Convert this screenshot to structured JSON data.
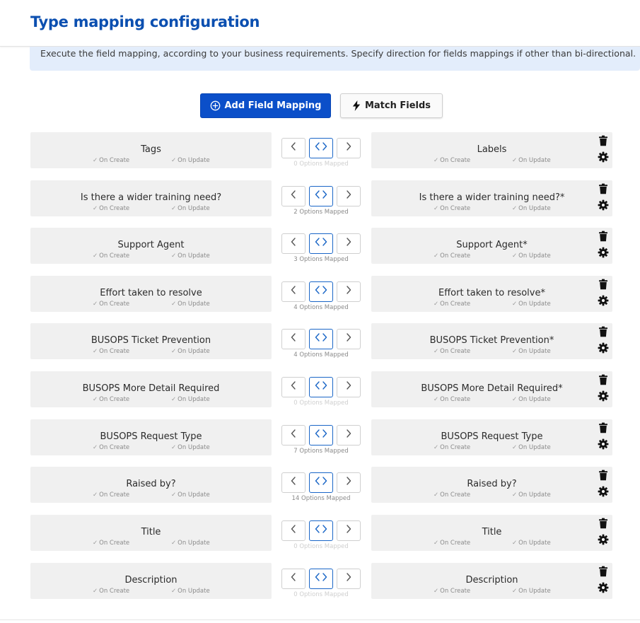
{
  "page": {
    "title": "Type mapping configuration"
  },
  "banner": {
    "text": "Execute the field mapping, according to your business requirements. Specify direction for fields mappings if other than bi-directional."
  },
  "toolbar": {
    "add_label": "Add Field Mapping",
    "match_label": "Match Fields"
  },
  "labels": {
    "on_create": "On Create",
    "on_update": "On Update"
  },
  "mappings": [
    {
      "left": "Tags",
      "right": "Labels",
      "options": "0 Options Mapped"
    },
    {
      "left": "Is there a wider training need?",
      "right": "Is there a wider training need?*",
      "options": "2 Options Mapped"
    },
    {
      "left": "Support Agent",
      "right": "Support Agent*",
      "options": "3 Options Mapped"
    },
    {
      "left": "Effort taken to resolve",
      "right": "Effort taken to resolve*",
      "options": "4 Options Mapped"
    },
    {
      "left": "BUSOPS Ticket Prevention",
      "right": "BUSOPS Ticket Prevention*",
      "options": "4 Options Mapped"
    },
    {
      "left": "BUSOPS More Detail Required",
      "right": "BUSOPS More Detail Required*",
      "options": "0 Options Mapped"
    },
    {
      "left": "BUSOPS Request Type",
      "right": "BUSOPS Request Type",
      "options": "7 Options Mapped"
    },
    {
      "left": "Raised by?",
      "right": "Raised by?",
      "options": "14 Options Mapped"
    },
    {
      "left": "Title",
      "right": "Title",
      "options": "0 Options Mapped"
    },
    {
      "left": "Description",
      "right": "Description",
      "options": "0 Options Mapped"
    }
  ],
  "icons": {
    "add": "plus-circle-icon",
    "match": "lightning-bolt-icon",
    "left": "chevron-left-icon",
    "both": "bidirectional-icon",
    "right": "chevron-right-icon",
    "delete": "trash-icon",
    "settings": "gear-icon",
    "check": "check-icon"
  },
  "colors": {
    "title": "#0b4fb0",
    "primary": "#0b4fc9",
    "banner": "#e3edfb",
    "field_bg": "#f0f0f0",
    "active_border": "#1a66c7"
  }
}
